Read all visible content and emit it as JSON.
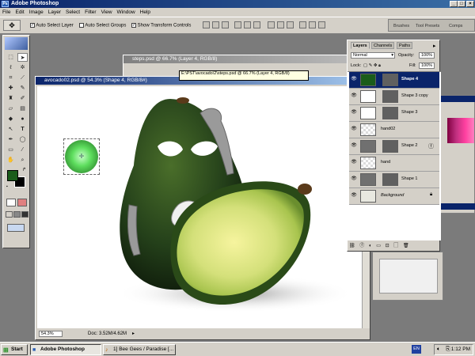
{
  "app": {
    "title": "Adobe Photoshop",
    "minimize": "_",
    "maximize": "□",
    "close": "×"
  },
  "menu": [
    "File",
    "Edit",
    "Image",
    "Layer",
    "Select",
    "Filter",
    "View",
    "Window",
    "Help"
  ],
  "options": {
    "auto_select_layer": "Auto Select Layer",
    "auto_select_groups": "Auto Select Groups",
    "show_transform_controls": "Show Transform Controls",
    "auto_select_layer_checked": true,
    "auto_select_groups_checked": false,
    "show_transform_controls_checked": true
  },
  "palette_well": {
    "tabs": [
      "Brushes",
      "Tool Presets",
      "Comps"
    ]
  },
  "documents": {
    "back": {
      "title": "steps.psd @ 66.7% (Layer 4, RGB/8)"
    },
    "tooltip": "E:\\PST\\avocado\\2\\steps.psd @ 66.7% (Layer 4, RGB/8)",
    "tooltip_heading": "Adobe Photoshop",
    "front": {
      "title": "avocado02.psd @ 54.3% (Shape 4, RGB/8#)",
      "zoom": "54.3%",
      "doc_size": "Doc: 3.52M/4.62M"
    }
  },
  "layers_panel": {
    "tabs": [
      "Layers",
      "Channels",
      "Paths"
    ],
    "blend_mode": "Normal",
    "opacity_label": "Opacity:",
    "opacity": "100%",
    "lock_label": "Lock:",
    "fill_label": "Fill:",
    "fill": "100%",
    "layers": [
      {
        "name": "Shape 4",
        "selected": true,
        "thumb": "#1a5c1a"
      },
      {
        "name": "Shape 3 copy",
        "selected": false,
        "thumb": "#ffffff"
      },
      {
        "name": "Shape 3",
        "selected": false,
        "thumb": "#ffffff"
      },
      {
        "name": "hand02",
        "selected": false,
        "thumb": "checker"
      },
      {
        "name": "Shape 2",
        "selected": false,
        "thumb": "#707070"
      },
      {
        "name": "hand",
        "selected": false,
        "thumb": "checker"
      },
      {
        "name": "Shape 1",
        "selected": false,
        "thumb": "#707070"
      },
      {
        "name": "Background",
        "selected": false,
        "thumb": "#e8e8e0"
      }
    ]
  },
  "taskbar": {
    "start": "Start",
    "items": [
      "Adobe Photoshop",
      "1] Bee Gees / Paradise [..."
    ],
    "language": "EN",
    "time": "1:12 PM"
  },
  "colors": {
    "foreground": "#1a5c1a",
    "background": "#000000",
    "titlebar": "#0a246a"
  }
}
